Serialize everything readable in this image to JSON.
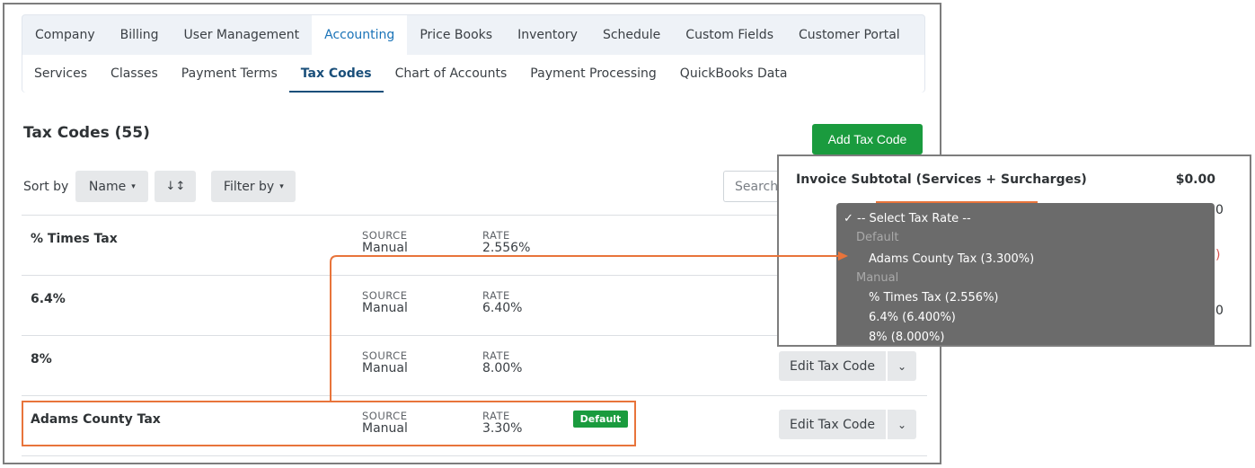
{
  "nav": {
    "tabs": [
      {
        "label": "Company"
      },
      {
        "label": "Billing"
      },
      {
        "label": "User Management"
      },
      {
        "label": "Accounting",
        "active": true
      },
      {
        "label": "Price Books"
      },
      {
        "label": "Inventory"
      },
      {
        "label": "Schedule"
      },
      {
        "label": "Custom Fields"
      },
      {
        "label": "Customer Portal"
      }
    ],
    "subtabs": [
      {
        "label": "Services"
      },
      {
        "label": "Classes"
      },
      {
        "label": "Payment Terms"
      },
      {
        "label": "Tax Codes",
        "active": true
      },
      {
        "label": "Chart of Accounts"
      },
      {
        "label": "Payment Processing"
      },
      {
        "label": "QuickBooks Data"
      }
    ]
  },
  "header": {
    "title": "Tax Codes (55)",
    "add_button": "Add Tax Code"
  },
  "toolbar": {
    "sort_label": "Sort by",
    "sort_field": "Name",
    "sort_direction_icon": "↓↕",
    "filter_label": "Filter by",
    "search_placeholder": "Search"
  },
  "table": {
    "source_header": "SOURCE",
    "rate_header": "RATE",
    "edit_label": "Edit Tax Code",
    "default_badge": "Default",
    "rows": [
      {
        "name": "% Times Tax",
        "source": "Manual",
        "rate": "2.556%"
      },
      {
        "name": "6.4%",
        "source": "Manual",
        "rate": "6.40%"
      },
      {
        "name": "8%",
        "source": "Manual",
        "rate": "8.00%"
      },
      {
        "name": "Adams County Tax",
        "source": "Manual",
        "rate": "3.30%",
        "default": true
      }
    ]
  },
  "callout": {
    "title": "Invoice Subtotal (Services + Surcharges)",
    "amount": "$0.00",
    "dropdown": {
      "selected": "✓ -- Select Tax Rate --",
      "group_default": "Default",
      "default_item": "Adams County Tax (3.300%)",
      "group_manual": "Manual",
      "manual_items": [
        "% Times Tax (2.556%)",
        "6.4% (6.400%)",
        "8% (8.000%)"
      ]
    }
  },
  "colors": {
    "accent_blue": "#1a73b8",
    "success_green": "#1a9b3e",
    "highlight_orange": "#e8743b"
  }
}
